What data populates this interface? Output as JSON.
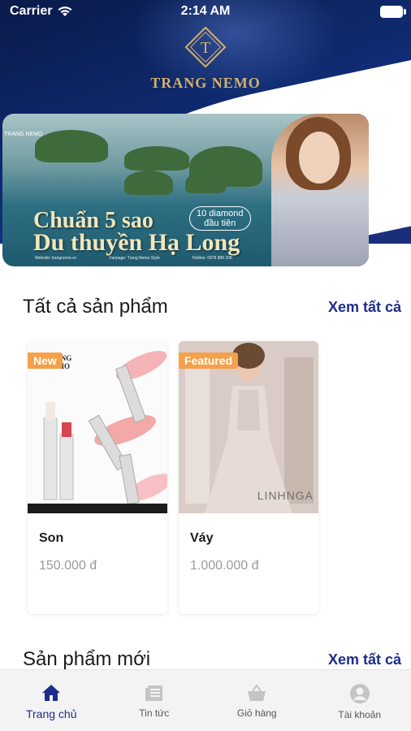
{
  "status_bar": {
    "carrier": "Carrier",
    "time": "2:14 AM"
  },
  "header": {
    "logo_monogram": "T",
    "brand_name": "TRANG NEMO"
  },
  "banner": {
    "headline_line1": "Chuẩn 5 sao",
    "headline_line2": "Du thuyền Hạ Long",
    "badge_line1": "10 diamond",
    "badge_line2": "đầu tiên",
    "corner_text": "TRANG NEMO",
    "footer_items": [
      "Website: trangnemo.vn",
      "Fanpage: Trang Nemo Style",
      "Hotline: 0978 888 208"
    ]
  },
  "sections": {
    "all_products": {
      "title": "Tất cả sản phẩm",
      "see_all": "Xem tất cả"
    },
    "new_products": {
      "title": "Sản phẩm mới",
      "see_all": "Xem tất cả"
    }
  },
  "products": [
    {
      "tag": "New",
      "name": "Son",
      "price": "150.000 đ",
      "brand_in_image": "TRANG NEMO"
    },
    {
      "tag": "Featured",
      "name": "Váy",
      "price": "1.000.000 đ",
      "brand_in_image": "LINHNGA"
    }
  ],
  "tab_bar": {
    "tabs": [
      {
        "label": "Trang chủ",
        "icon": "home-icon",
        "active": true
      },
      {
        "label": "Tin tức",
        "icon": "news-icon",
        "active": false
      },
      {
        "label": "Giỏ hàng",
        "icon": "cart-icon",
        "active": false
      },
      {
        "label": "Tài khoản",
        "icon": "account-icon",
        "active": false
      }
    ]
  },
  "colors": {
    "accent": "#1d2c8c",
    "tag_orange": "#f5a04a",
    "header_navy": "#0e2a6e",
    "logo_gold": "#d4b06a",
    "price_gray": "#9a9a9a"
  }
}
